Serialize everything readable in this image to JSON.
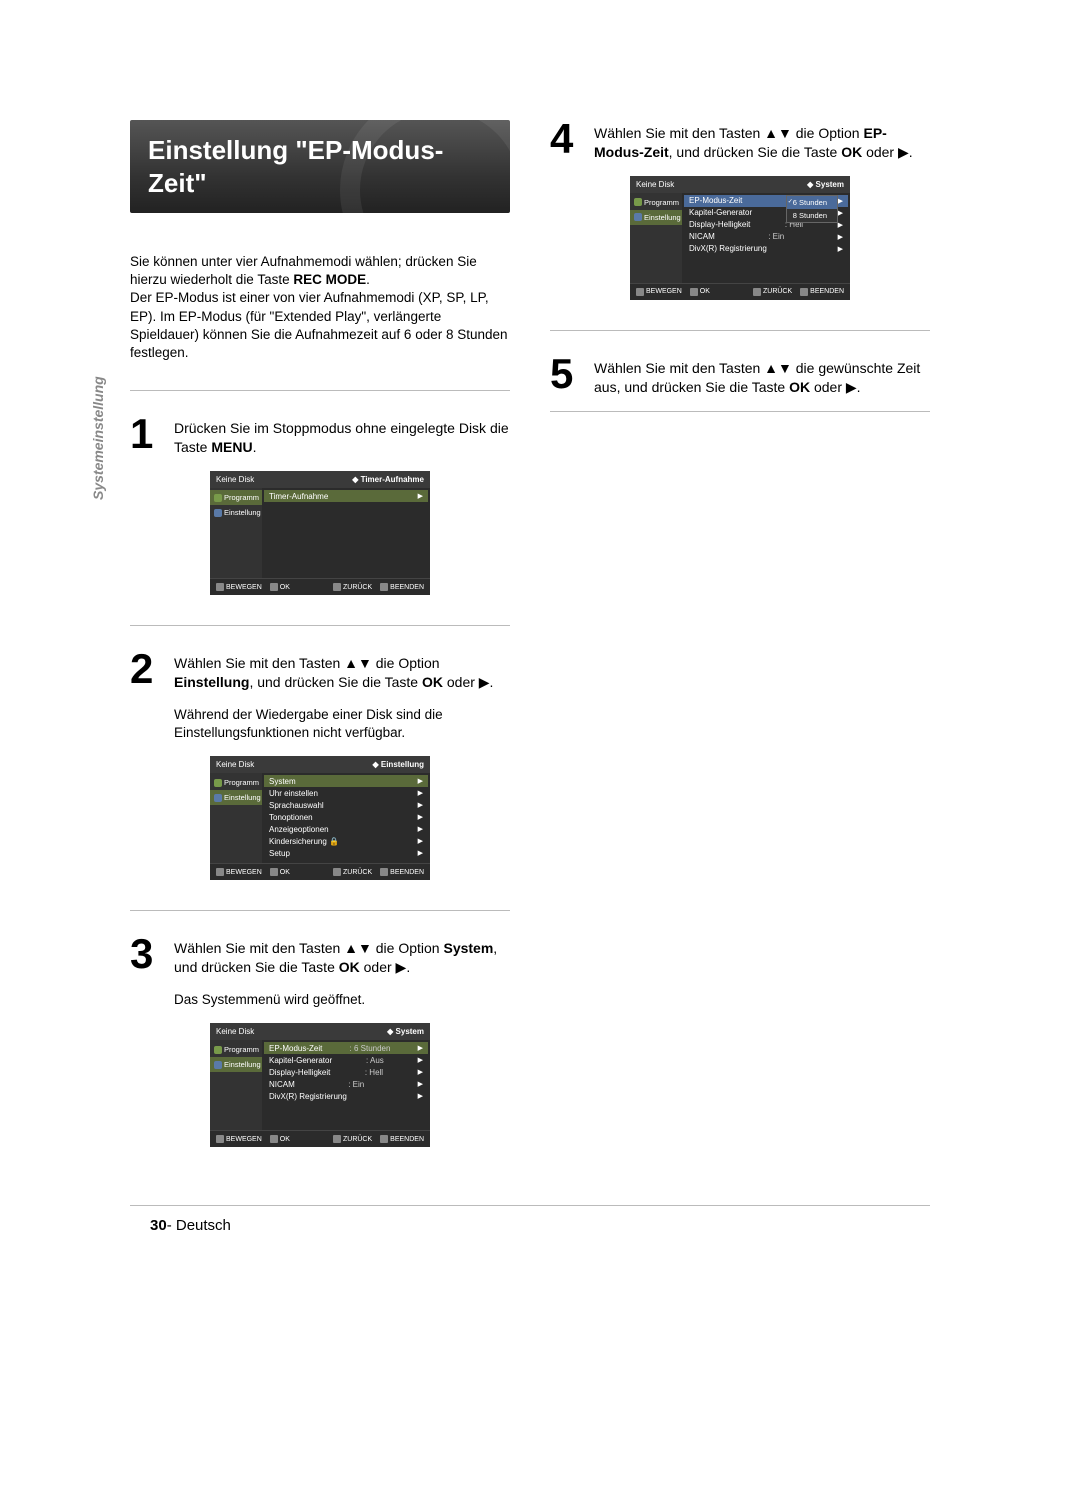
{
  "side_label": "Systemeinstellung",
  "title": "Einstellung \"EP-Modus-Zeit\"",
  "intro_lines": [
    "Sie können unter vier Aufnahmemodi wählen; drücken Sie hierzu wiederholt die Taste",
    "REC MODE",
    ".",
    "Der EP-Modus ist einer von vier Aufnahmemodi (XP, SP, LP, EP). Im EP-Modus (für \"Extended Play\", verlängerte Spieldauer) können Sie die Aufnahmezeit auf 6 oder 8 Stunden festlegen."
  ],
  "steps": {
    "s1": {
      "num": "1",
      "text_a": "Drücken Sie im Stoppmodus ohne eingelegte Disk die Taste",
      "bold": "MENU",
      "text_b": "."
    },
    "s2": {
      "num": "2",
      "text_a": "Wählen Sie mit den Tasten ▲▼ die Option",
      "bold": "Einstellung",
      "text_b": ", und drücken Sie die Taste",
      "bold2": "OK",
      "text_c": "oder ▶.",
      "extra": "Während der Wiedergabe einer Disk sind die Einstellungsfunktionen nicht verfügbar."
    },
    "s3": {
      "num": "3",
      "text_a": "Wählen Sie mit den Tasten ▲▼ die Option",
      "bold": "System",
      "text_b": ", und drücken Sie die Taste",
      "bold2": "OK",
      "text_c": "oder  ▶.",
      "extra": "Das Systemmenü wird geöffnet."
    },
    "s4": {
      "num": "4",
      "text_a": "Wählen Sie mit den Tasten ▲▼ die Option",
      "bold": "EP-Modus-Zeit",
      "text_b": ", und drücken Sie die Taste",
      "bold2": "OK",
      "text_c": "oder ▶."
    },
    "s5": {
      "num": "5",
      "text_a": "Wählen Sie mit den Tasten ▲▼ die gewünschte Zeit aus, und drücken Sie die Taste",
      "bold": "OK",
      "text_b": "oder ▶."
    }
  },
  "osd": {
    "header_left": "Keine Disk",
    "crumb_timer": "Timer-Aufnahme",
    "crumb_einstellung": "Einstellung",
    "crumb_system": "System",
    "side": {
      "programm": "Programm",
      "einstellung": "Einstellung"
    },
    "rows_timer": {
      "r1": "Timer-Aufnahme"
    },
    "rows_einst": {
      "r1": "System",
      "r2": "Uhr einstellen",
      "r3": "Sprachauswahl",
      "r4": "Tonoptionen",
      "r5": "Anzeigeoptionen",
      "r6": "Kindersicherung",
      "r6_lock": "🔒",
      "r7": "Setup"
    },
    "rows_system": {
      "r1": "EP-Modus-Zeit",
      "v1": ": 6 Stunden",
      "r2": "Kapitel-Generator",
      "v2": ": Aus",
      "r3": "Display-Helligkeit",
      "v3": ": Hell",
      "r4": "NICAM",
      "v4": ": Ein",
      "r5": "DivX(R) Registrierung"
    },
    "popup": {
      "opt1": "6 Stunden",
      "opt2": "8 Stunden"
    },
    "footer": {
      "bewegen": "BEWEGEN",
      "ok": "OK",
      "zurueck": "ZURÜCK",
      "beenden": "BEENDEN"
    }
  },
  "page_footer": {
    "num": "30",
    "sep": "-",
    "lang": "Deutsch"
  }
}
